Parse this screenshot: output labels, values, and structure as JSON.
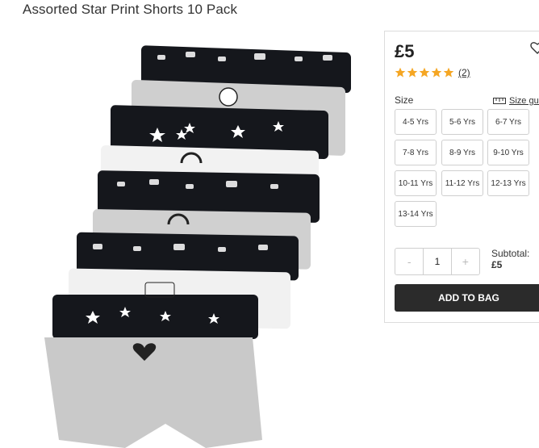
{
  "product": {
    "title": "Assorted Star Print Shorts 10 Pack",
    "price": "£5",
    "rating": 5,
    "review_count": "(2)",
    "size_label": "Size",
    "size_guide": "Size guide",
    "sizes": [
      "4-5 Yrs",
      "5-6 Yrs",
      "6-7 Yrs",
      "7-8 Yrs",
      "8-9 Yrs",
      "9-10 Yrs",
      "10-11 Yrs",
      "11-12 Yrs",
      "12-13 Yrs",
      "13-14 Yrs"
    ],
    "quantity": {
      "minus": "-",
      "value": "1",
      "plus": "+"
    },
    "subtotal_label": "Subtotal:",
    "subtotal_value": "£5",
    "add_button": "ADD TO BAG"
  },
  "colors": {
    "star": "#f5a623",
    "button": "#2b2b2b",
    "black_fabric": "#15171c",
    "grey_fabric": "#c7c7c7",
    "white_fabric": "#f2f2f2"
  },
  "icons": {
    "wishlist": "heart-icon",
    "size_guide": "ruler-icon",
    "rating": "star-icon"
  }
}
